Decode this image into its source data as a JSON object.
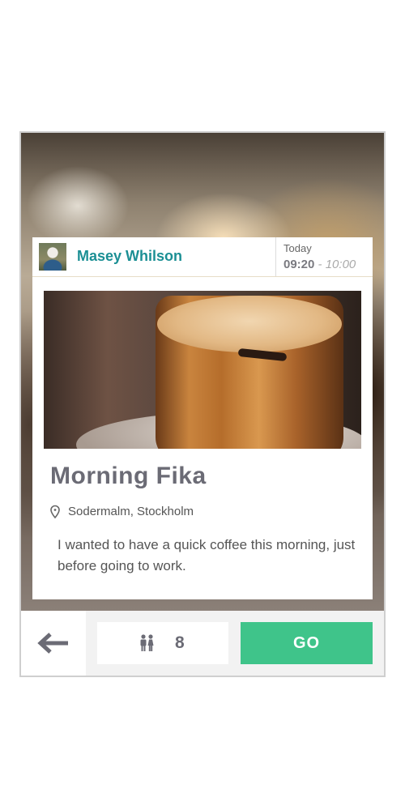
{
  "event": {
    "author": "Masey Whilson",
    "day": "Today",
    "time_start": "09:20",
    "time_separator": " - ",
    "time_end": "10:00",
    "title": "Morning Fika",
    "location": "Sodermalm, Stockholm",
    "description": "I wanted to have a quick coffee this morning, just before going to work."
  },
  "footer": {
    "attendee_count": "8",
    "go_label": "GO"
  },
  "icons": {
    "back": "arrow-left-icon",
    "people": "people-icon",
    "location": "map-pin-icon"
  },
  "colors": {
    "accent": "#1b8f94",
    "go_button": "#3fc48a",
    "title_text": "#6b6b75"
  }
}
